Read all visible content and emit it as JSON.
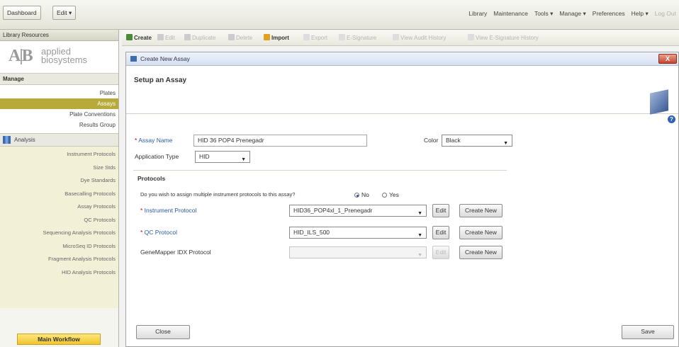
{
  "topbar": {
    "dashboard": "Dashboard",
    "edit": "Edit ▾",
    "menu": [
      "Library",
      "Maintenance",
      "Tools ▾",
      "Manage ▾",
      "Preferences",
      "Help ▾"
    ],
    "logout": "Log Out"
  },
  "sidebar": {
    "header": "Library Resources",
    "logo": {
      "mark": "A|B",
      "line1": "applied",
      "line2": "biosystems"
    },
    "manage_title": "Manage",
    "manage_items": [
      "Plates",
      "Assays",
      "Plate Conventions",
      "Results Group"
    ],
    "alerts_title": "Analysis",
    "protocols": [
      "Instrument Protocols",
      "Size Stds",
      "Dye Standards",
      "Basecalling Protocols",
      "Assay Protocols",
      "QC Protocols",
      "Sequencing Analysis Protocols",
      "MicroSeq ID Protocols",
      "Fragment Analysis Protocols",
      "HID Analysis Protocols"
    ],
    "main_workflow": "Main Workflow"
  },
  "toolbar": {
    "create": "Create",
    "edit": "Edit",
    "duplicate": "Duplicate",
    "delete": "Delete",
    "import": "Import",
    "export": "Export",
    "esignature": "E-Signature",
    "audit": "View Audit History",
    "esig_history": "View E-Signature History"
  },
  "dialog": {
    "title": "Create New Assay",
    "close": "X",
    "setup_title": "Setup an Assay",
    "help": "?",
    "assay_name_label": "Assay Name",
    "assay_name_value": "HID 36 POP4 Prenegadr",
    "color_label": "Color",
    "color_value": "Black",
    "app_type_label": "Application Type",
    "app_type_value": "HID",
    "protocols_title": "Protocols",
    "multi_question": "Do you wish to assign multiple instrument protocols to this assay?",
    "no": "No",
    "yes": "Yes",
    "instrument_label": "Instrument Protocol",
    "instrument_value": "HID36_POP4xl_1_Prenegadr",
    "qc_label": "QC Protocol",
    "qc_value": "HID_ILS_500",
    "mapper_label": "GeneMapper IDX Protocol",
    "mapper_value": "",
    "edit": "Edit",
    "create_new": "Create New",
    "close_btn": "Close",
    "save_btn": "Save"
  },
  "colors": {
    "accent": "#b8aa3a",
    "required_label": "#2a5aa6",
    "workflow_button": "#f0c430"
  }
}
